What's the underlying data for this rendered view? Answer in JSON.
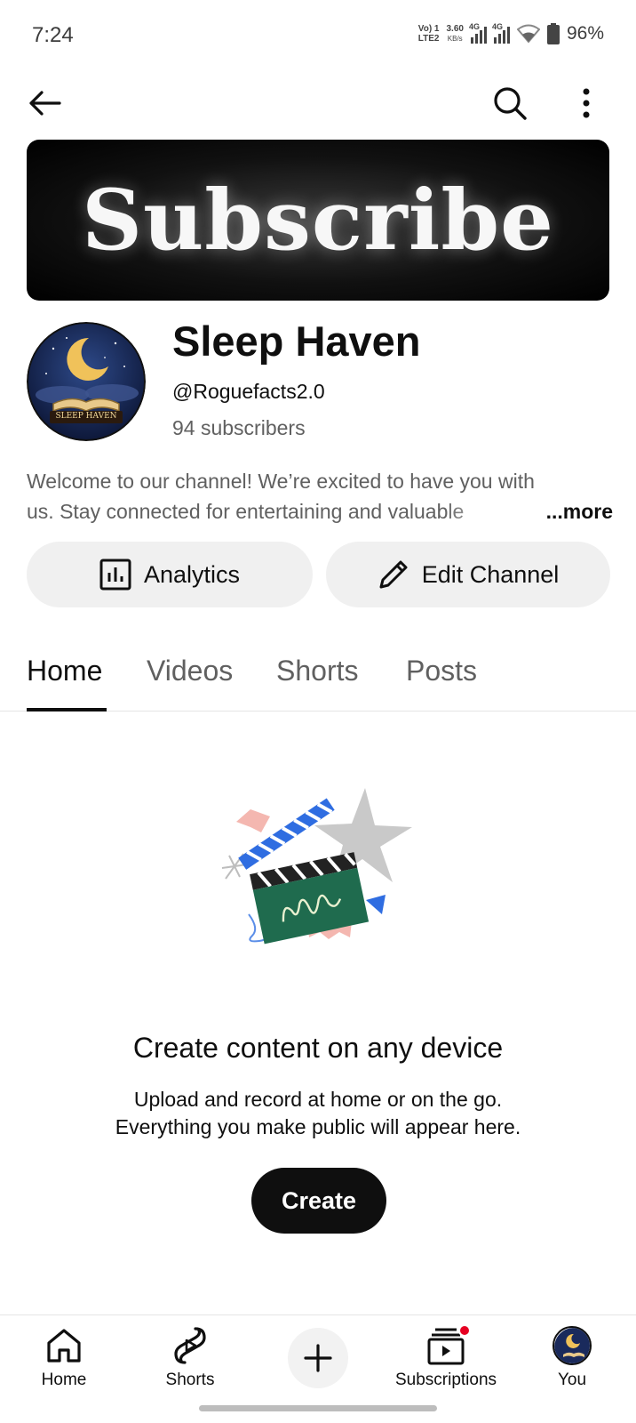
{
  "status_bar": {
    "time": "7:24",
    "volte": "Vo) 1",
    "lte": "LTE2",
    "speed": "3.60",
    "speed_unit": "KB/s",
    "net1": "4G",
    "net2": "4G",
    "battery": "96%"
  },
  "header": {
    "back_icon": "back-arrow-icon",
    "search_icon": "search-icon",
    "more_icon": "more-vertical-icon"
  },
  "banner": {
    "text": "Subscribe"
  },
  "channel": {
    "name": "Sleep Haven",
    "handle": "@Roguefacts2.0",
    "subscribers": "94 subscribers",
    "avatar_text": "SLEEP HAVEN",
    "description_line1": "Welcome to our channel! We’re excited to have you with",
    "description_line2": "us. Stay connected for entertaining and valuable",
    "more_label": "...more"
  },
  "actions": {
    "analytics_label": "Analytics",
    "edit_label": "Edit Channel"
  },
  "tabs": [
    {
      "label": "Home",
      "active": true
    },
    {
      "label": "Videos",
      "active": false
    },
    {
      "label": "Shorts",
      "active": false
    },
    {
      "label": "Posts",
      "active": false
    }
  ],
  "empty_state": {
    "title": "Create content on any device",
    "subtitle_line1": "Upload and record at home or on the go.",
    "subtitle_line2": "Everything you make public will appear here.",
    "create_label": "Create"
  },
  "bottom_nav": [
    {
      "label": "Home",
      "icon": "home-icon"
    },
    {
      "label": "Shorts",
      "icon": "shorts-icon"
    },
    {
      "label": "",
      "icon": "plus-icon"
    },
    {
      "label": "Subscriptions",
      "icon": "subscriptions-icon"
    },
    {
      "label": "You",
      "icon": "avatar-icon"
    }
  ],
  "colors": {
    "text_primary": "#0f0f0f",
    "text_secondary": "#606060",
    "button_bg": "#f0f0f0",
    "notification": "#e60023"
  }
}
